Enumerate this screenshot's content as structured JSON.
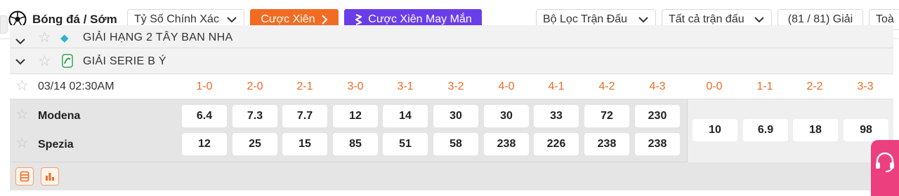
{
  "toolbar": {
    "sport_label": "Bóng đá / Sớm",
    "market_select": "Tỷ Số Chính Xác",
    "parlay_button": "Cược Xiên",
    "lucky_parlay_button": "Cược Xiên May Mắn",
    "match_filter": "Bộ Lọc Trận Đấu",
    "match_scope": "Tất cả trận đấu",
    "league_count": "(81 / 81) Giải",
    "truncated_item": "Toà"
  },
  "leagues": [
    {
      "name": "GIẢI HẠNG 2 TÂY BAN NHA"
    },
    {
      "name": "GIẢI SERIE B Ý"
    }
  ],
  "header": {
    "datetime": "03/14 02:30AM",
    "home_scores": [
      "1-0",
      "2-0",
      "2-1",
      "3-0",
      "3-1",
      "3-2",
      "4-0",
      "4-1",
      "4-2",
      "4-3"
    ],
    "draw_scores": [
      "0-0",
      "1-1",
      "2-2",
      "3-3"
    ]
  },
  "match": {
    "home_team": "Modena",
    "away_team": "Spezia",
    "home_odds": [
      "6.4",
      "7.3",
      "7.7",
      "12",
      "14",
      "30",
      "30",
      "33",
      "72",
      "230"
    ],
    "away_odds": [
      "12",
      "25",
      "15",
      "85",
      "51",
      "58",
      "238",
      "226",
      "238",
      "238"
    ],
    "draw_odds": [
      "10",
      "6.9",
      "18",
      "98"
    ]
  },
  "colors": {
    "accent_orange": "#f26b22",
    "accent_purple": "#6a3dea",
    "support_pink": "#ec3f7e"
  },
  "icons": [
    "soccer-ball-icon",
    "chevron-down-icon",
    "chevron-right-icon",
    "lucky-icon",
    "star-icon",
    "league-logo-icon",
    "stats-list-icon",
    "bar-chart-icon",
    "headset-icon"
  ]
}
